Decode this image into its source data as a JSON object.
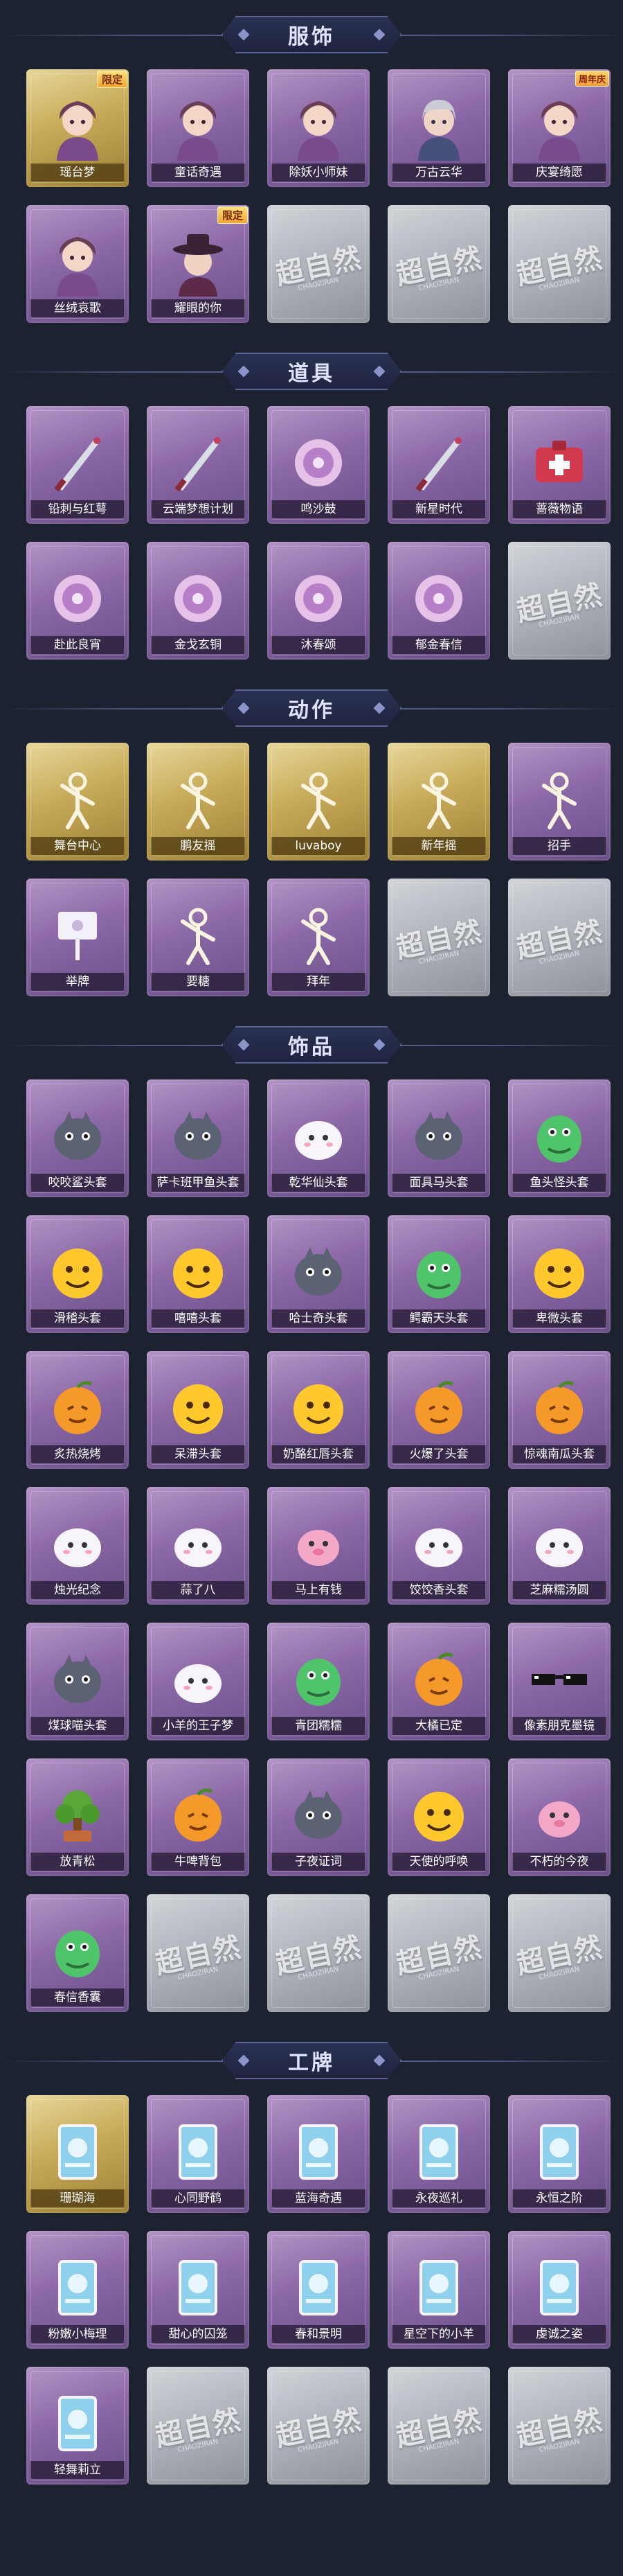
{
  "colors": {
    "background": "#1d2230",
    "card_purple": "#8b68a6",
    "card_gold": "#c7aa58",
    "card_empty": "#a8acb4",
    "badge": "#f2a531"
  },
  "empty_placeholder": {
    "logo": "超自然",
    "sub": "CHAOZIRAN"
  },
  "sections": [
    {
      "title": "服饰",
      "items": [
        {
          "label": "瑶台梦",
          "style": "gold",
          "badge": "限定",
          "icon": "lady-portrait-icon"
        },
        {
          "label": "童话奇遇",
          "style": "purple",
          "icon": "girl-portrait-icon"
        },
        {
          "label": "除妖小师妹",
          "style": "purple",
          "icon": "girl-portrait-icon"
        },
        {
          "label": "万古云华",
          "style": "purple",
          "icon": "boy-portrait-icon"
        },
        {
          "label": "庆宴绮愿",
          "style": "purple",
          "badge": "周年庆",
          "icon": "lady-portrait-icon"
        },
        {
          "label": "丝绒哀歌",
          "style": "purple",
          "icon": "lady-portrait-icon"
        },
        {
          "label": "耀眼的你",
          "style": "purple",
          "badge": "限定",
          "icon": "hat-portrait-icon"
        },
        {
          "label": "",
          "style": "empty"
        },
        {
          "label": "",
          "style": "empty"
        },
        {
          "label": "",
          "style": "empty"
        }
      ]
    },
    {
      "title": "道具",
      "items": [
        {
          "label": "铅刺与红萼",
          "style": "purple",
          "icon": "sword-icon"
        },
        {
          "label": "云端梦想计划",
          "style": "purple",
          "icon": "wand-icon"
        },
        {
          "label": "鸣沙鼓",
          "style": "purple",
          "icon": "drum-icon"
        },
        {
          "label": "新星时代",
          "style": "purple",
          "icon": "pistol-icon"
        },
        {
          "label": "蔷薇物语",
          "style": "purple",
          "icon": "medkit-icon"
        },
        {
          "label": "赴此良宵",
          "style": "purple",
          "icon": "umbrella-icon"
        },
        {
          "label": "金戈玄铜",
          "style": "purple",
          "icon": "lantern-icon"
        },
        {
          "label": "沐春颂",
          "style": "purple",
          "icon": "wreath-icon"
        },
        {
          "label": "郁金春信",
          "style": "purple",
          "icon": "parasol-icon"
        },
        {
          "label": "",
          "style": "empty"
        }
      ]
    },
    {
      "title": "动作",
      "items": [
        {
          "label": "舞台中心",
          "style": "gold",
          "icon": "pose-icon"
        },
        {
          "label": "鹏友摇",
          "style": "gold",
          "icon": "pose-icon"
        },
        {
          "label": "luvaboy",
          "style": "gold",
          "icon": "pose-icon"
        },
        {
          "label": "新年摇",
          "style": "gold",
          "icon": "pose-icon"
        },
        {
          "label": "招手",
          "style": "purple",
          "icon": "wave-icon"
        },
        {
          "label": "举牌",
          "style": "purple",
          "icon": "sign-icon"
        },
        {
          "label": "要糖",
          "style": "purple",
          "icon": "pose-icon"
        },
        {
          "label": "拜年",
          "style": "purple",
          "icon": "pose-icon"
        },
        {
          "label": "",
          "style": "empty"
        },
        {
          "label": "",
          "style": "empty"
        }
      ]
    },
    {
      "title": "饰品",
      "items": [
        {
          "label": "咬咬鲨头套",
          "style": "purple",
          "icon": "shark-icon"
        },
        {
          "label": "萨卡班甲鱼头套",
          "style": "purple",
          "icon": "fish-icon"
        },
        {
          "label": "乾华仙头套",
          "style": "purple",
          "icon": "bear-icon"
        },
        {
          "label": "面具马头套",
          "style": "purple",
          "icon": "horse-icon"
        },
        {
          "label": "鱼头怪头套",
          "style": "purple",
          "icon": "frog-icon"
        },
        {
          "label": "滑稽头套",
          "style": "purple",
          "icon": "smile-icon"
        },
        {
          "label": "嘻嘻头套",
          "style": "purple",
          "icon": "grin-icon"
        },
        {
          "label": "哈士奇头套",
          "style": "purple",
          "icon": "dog-icon"
        },
        {
          "label": "鳄霸天头套",
          "style": "purple",
          "icon": "croc-icon"
        },
        {
          "label": "卑微头套",
          "style": "purple",
          "icon": "shy-icon"
        },
        {
          "label": "炙热烧烤",
          "style": "purple",
          "icon": "toast-icon"
        },
        {
          "label": "呆滞头套",
          "style": "purple",
          "icon": "dazed-icon"
        },
        {
          "label": "奶酪红唇头套",
          "style": "purple",
          "icon": "pika-icon"
        },
        {
          "label": "火爆了头套",
          "style": "purple",
          "icon": "flame-icon"
        },
        {
          "label": "惊魂南瓜头套",
          "style": "purple",
          "icon": "pumpkin-icon"
        },
        {
          "label": "烛光纪念",
          "style": "purple",
          "icon": "candle-icon"
        },
        {
          "label": "蒜了八",
          "style": "purple",
          "icon": "garlic-icon"
        },
        {
          "label": "马上有钱",
          "style": "purple",
          "icon": "pony-icon"
        },
        {
          "label": "饺饺香头套",
          "style": "purple",
          "icon": "dumpling-icon"
        },
        {
          "label": "芝麻糯汤圆",
          "style": "purple",
          "icon": "ball-icon"
        },
        {
          "label": "煤球喵头套",
          "style": "purple",
          "icon": "cat-icon"
        },
        {
          "label": "小羊的王子梦",
          "style": "purple",
          "icon": "sheep-icon"
        },
        {
          "label": "青团糯糯",
          "style": "purple",
          "icon": "bun-icon"
        },
        {
          "label": "大橘已定",
          "style": "purple",
          "icon": "orange-icon"
        },
        {
          "label": "像素朋克墨镜",
          "style": "purple",
          "icon": "glasses-icon"
        },
        {
          "label": "放青松",
          "style": "purple",
          "icon": "bonsai-icon"
        },
        {
          "label": "牛啤背包",
          "style": "purple",
          "icon": "backpack-icon"
        },
        {
          "label": "子夜证词",
          "style": "purple",
          "icon": "owl-icon"
        },
        {
          "label": "天使的呼唤",
          "style": "purple",
          "icon": "angel-icon"
        },
        {
          "label": "不朽的今夜",
          "style": "purple",
          "icon": "piglet-icon"
        },
        {
          "label": "春信香囊",
          "style": "purple",
          "icon": "pouch-icon"
        },
        {
          "label": "",
          "style": "empty"
        },
        {
          "label": "",
          "style": "empty"
        },
        {
          "label": "",
          "style": "empty"
        },
        {
          "label": "",
          "style": "empty"
        }
      ]
    },
    {
      "title": "工牌",
      "items": [
        {
          "label": "珊瑚海",
          "style": "gold",
          "icon": "badge-card-icon"
        },
        {
          "label": "心同野鹤",
          "style": "purple",
          "icon": "badge-card-icon"
        },
        {
          "label": "蓝海奇遇",
          "style": "purple",
          "icon": "badge-card-icon"
        },
        {
          "label": "永夜巡礼",
          "style": "purple",
          "icon": "badge-card-icon"
        },
        {
          "label": "永恒之阶",
          "style": "purple",
          "icon": "badge-card-icon"
        },
        {
          "label": "粉嫩小梅理",
          "style": "purple",
          "icon": "badge-card-icon"
        },
        {
          "label": "甜心的囚笼",
          "style": "purple",
          "icon": "badge-card-icon"
        },
        {
          "label": "春和景明",
          "style": "purple",
          "icon": "badge-card-icon"
        },
        {
          "label": "星空下的小羊",
          "style": "purple",
          "icon": "badge-card-icon"
        },
        {
          "label": "虔诚之姿",
          "style": "purple",
          "icon": "badge-card-icon"
        },
        {
          "label": "轻舞莉立",
          "style": "purple",
          "icon": "badge-card-icon"
        },
        {
          "label": "",
          "style": "empty"
        },
        {
          "label": "",
          "style": "empty"
        },
        {
          "label": "",
          "style": "empty"
        },
        {
          "label": "",
          "style": "empty"
        }
      ]
    }
  ]
}
